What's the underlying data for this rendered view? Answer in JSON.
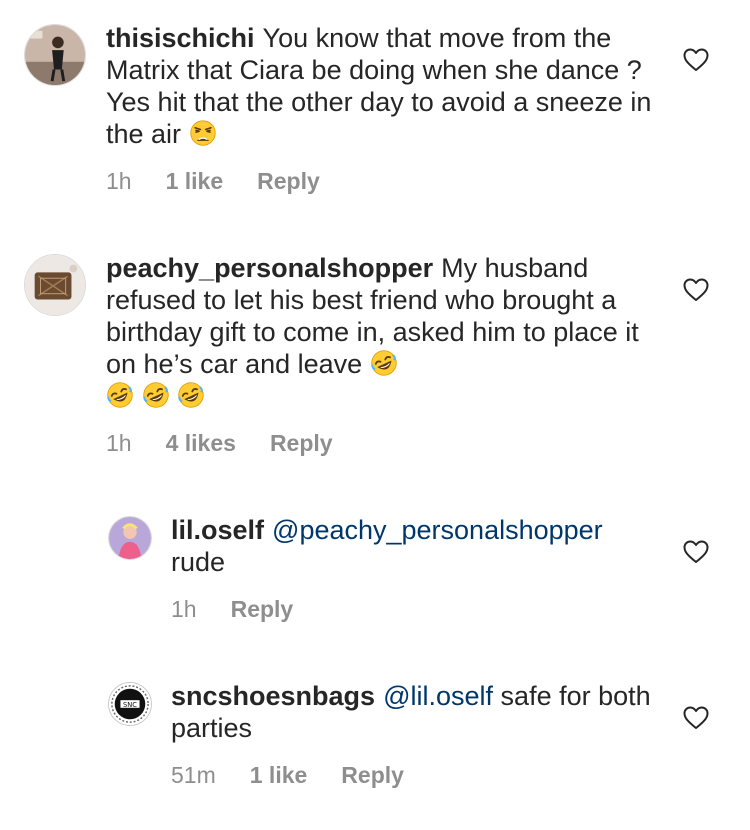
{
  "comments": [
    {
      "username": "thisischichi",
      "text": "You know that move from the Matrix that Ciara be doing when she dance ? Yes hit that the other day to avoid a sneeze in the air",
      "emoji_trailing": "weary-face",
      "time": "1h",
      "likes": "1 like",
      "reply": "Reply"
    },
    {
      "username": "peachy_personalshopper",
      "text": "My husband refused to let his best friend who brought a birthday gift to come in, asked him to place it on he’s car and leave",
      "emoji_trailing": "rofl-face x4",
      "time": "1h",
      "likes": "4 likes",
      "reply": "Reply"
    },
    {
      "username": "lil.oself",
      "mention": "@peachy_personalshopper",
      "text": "rude",
      "time": "1h",
      "reply": "Reply"
    },
    {
      "username": "sncshoesnbags",
      "mention": "@lil.oself",
      "text": "safe for both parties",
      "time": "51m",
      "likes": "1 like",
      "reply": "Reply"
    }
  ],
  "colors": {
    "text": "#262626",
    "secondary": "#8e8e8e",
    "mention": "#00376b"
  },
  "icons": [
    "heart-outline-icon",
    "weary-face-emoji",
    "rofl-face-emoji"
  ]
}
